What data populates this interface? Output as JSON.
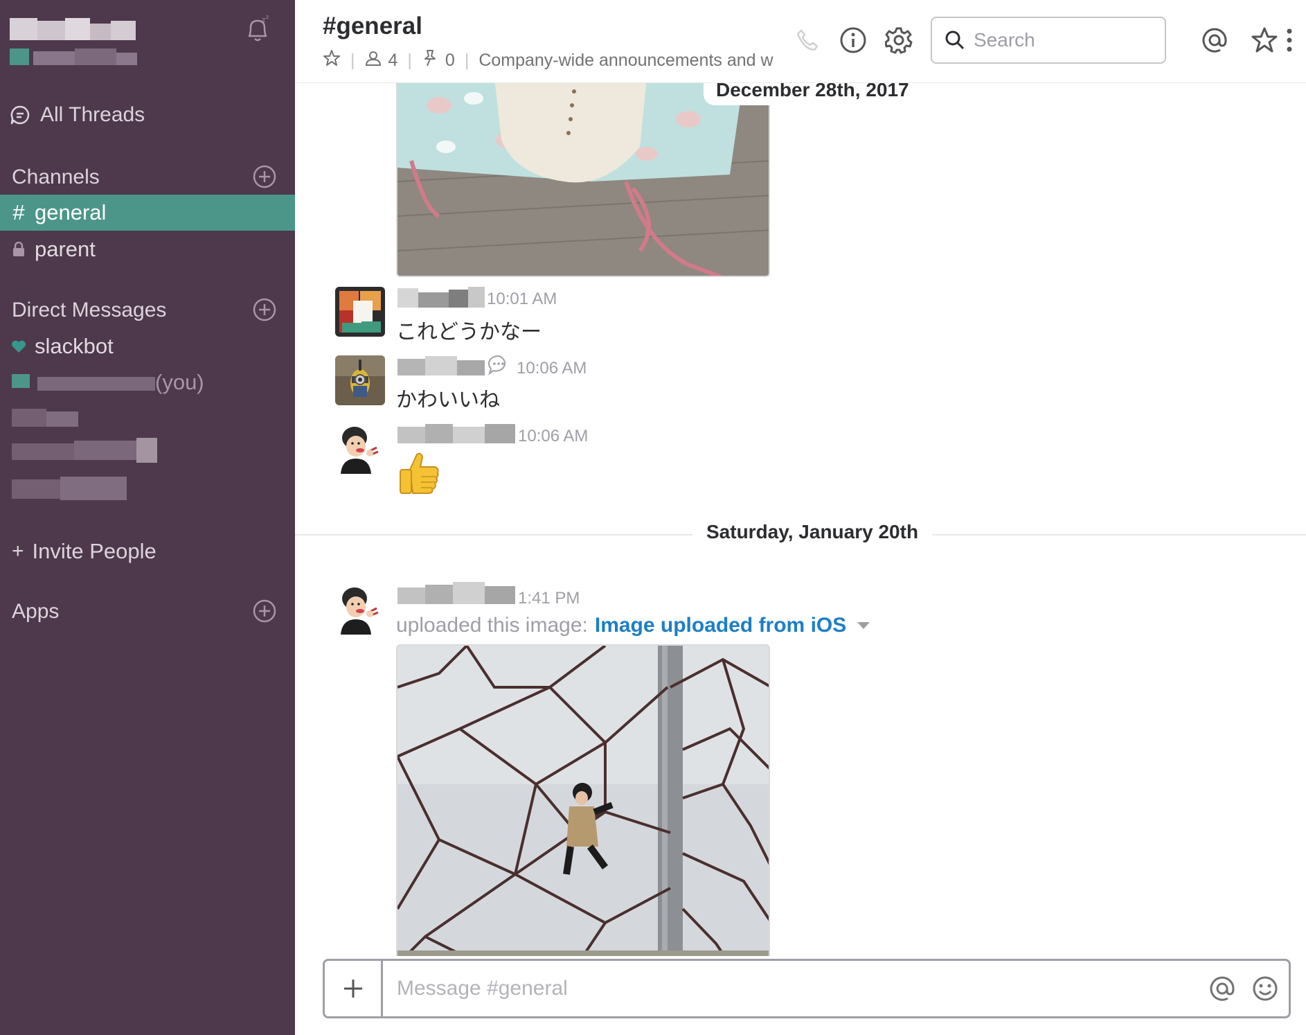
{
  "sidebar": {
    "all_threads_label": "All Threads",
    "channels_label": "Channels",
    "channels": [
      {
        "prefix": "#",
        "label": "general",
        "active": true
      },
      {
        "prefix": "lock",
        "label": "parent",
        "active": false
      }
    ],
    "direct_messages_label": "Direct Messages",
    "dms": [
      {
        "label": "slackbot"
      }
    ],
    "you_label": "(you)",
    "invite_label": "Invite People",
    "apps_label": "Apps",
    "colors": {
      "background": "#4d394b",
      "active": "#4c9689",
      "presence": "#38978d"
    }
  },
  "header": {
    "channel_title": "#general",
    "member_count": "4",
    "pinned_count": "0",
    "purpose": "Company-wide announcements and w",
    "search_placeholder": "Search",
    "icons": [
      "phone-icon",
      "info-icon",
      "gear-icon",
      "at-icon",
      "star-icon",
      "more-vertical-icon"
    ]
  },
  "messages": {
    "day_1": "December 28th, 2017",
    "items": [
      {
        "time": "10:01 AM",
        "text": "これどうかなー"
      },
      {
        "time": "10:06 AM",
        "text": "かわいいね"
      },
      {
        "time": "10:06 AM",
        "emoji": "thumbs-up"
      }
    ],
    "day_2": "Saturday, January 20th",
    "upload": {
      "time": "1:41 PM",
      "prefix": "uploaded this image:",
      "link": "Image uploaded from iOS"
    }
  },
  "composer": {
    "placeholder": "Message #general"
  }
}
